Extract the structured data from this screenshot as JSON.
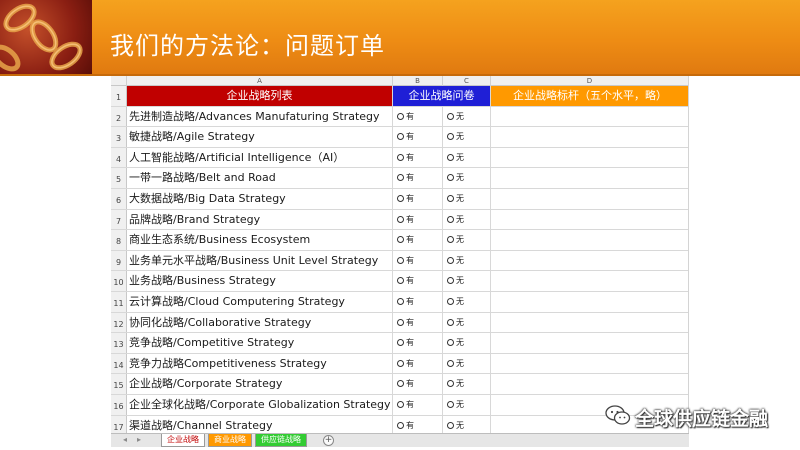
{
  "slide": {
    "title": "我们的方法论：问题订单"
  },
  "spreadsheet": {
    "column_letters": [
      "A",
      "B",
      "C",
      "D"
    ],
    "header": {
      "row_number": "1",
      "col_a": "企业战略列表",
      "col_bc": "企业战略问卷",
      "col_d": "企业战略标杆（五个水平，略）"
    },
    "option_yes": "有",
    "option_no": "无",
    "rows": [
      {
        "num": "2",
        "name": "先进制造战略/Advances Manufaturing Strategy"
      },
      {
        "num": "3",
        "name": "敏捷战略/Agile Strategy"
      },
      {
        "num": "4",
        "name": "人工智能战略/Artificial Intelligence（AI）"
      },
      {
        "num": "5",
        "name": "一带一路战略/Belt and Road"
      },
      {
        "num": "6",
        "name": "大数据战略/Big Data Strategy"
      },
      {
        "num": "7",
        "name": "品牌战略/Brand Strategy"
      },
      {
        "num": "8",
        "name": "商业生态系统/Business Ecosystem"
      },
      {
        "num": "9",
        "name": "业务单元水平战略/Business Unit Level  Strategy"
      },
      {
        "num": "10",
        "name": "业务战略/Business Strategy"
      },
      {
        "num": "11",
        "name": "云计算战略/Cloud Computering Strategy"
      },
      {
        "num": "12",
        "name": "协同化战略/Collaborative Strategy"
      },
      {
        "num": "13",
        "name": "竞争战略/Competitive Strategy"
      },
      {
        "num": "14",
        "name": "竞争力战略Competitiveness Strategy"
      },
      {
        "num": "15",
        "name": "企业战略/Corporate Strategy"
      },
      {
        "num": "16",
        "name": "企业全球化战略/Corporate Globalization Strategy"
      },
      {
        "num": "17",
        "name": "渠道战略/Channel Strategy"
      }
    ]
  },
  "sheet_tabs": {
    "nav_prev": "◂",
    "nav_next": "▸",
    "add": "+",
    "tabs": [
      {
        "label": "企业战略",
        "color": "#ffffff",
        "text_color": "#c00000"
      },
      {
        "label": "商业战略",
        "color": "#ff9900",
        "text_color": "#ffffff"
      },
      {
        "label": "供应链战略",
        "color": "#33cc33",
        "text_color": "#ffffff"
      }
    ]
  },
  "watermark": {
    "text": "全球供应链金融",
    "icon": "wechat-icon"
  },
  "colors": {
    "header_orange": "#ee8c14",
    "col_a_header": "#c00000",
    "col_bc_header": "#1f1fd6",
    "col_d_header": "#ff9900"
  }
}
